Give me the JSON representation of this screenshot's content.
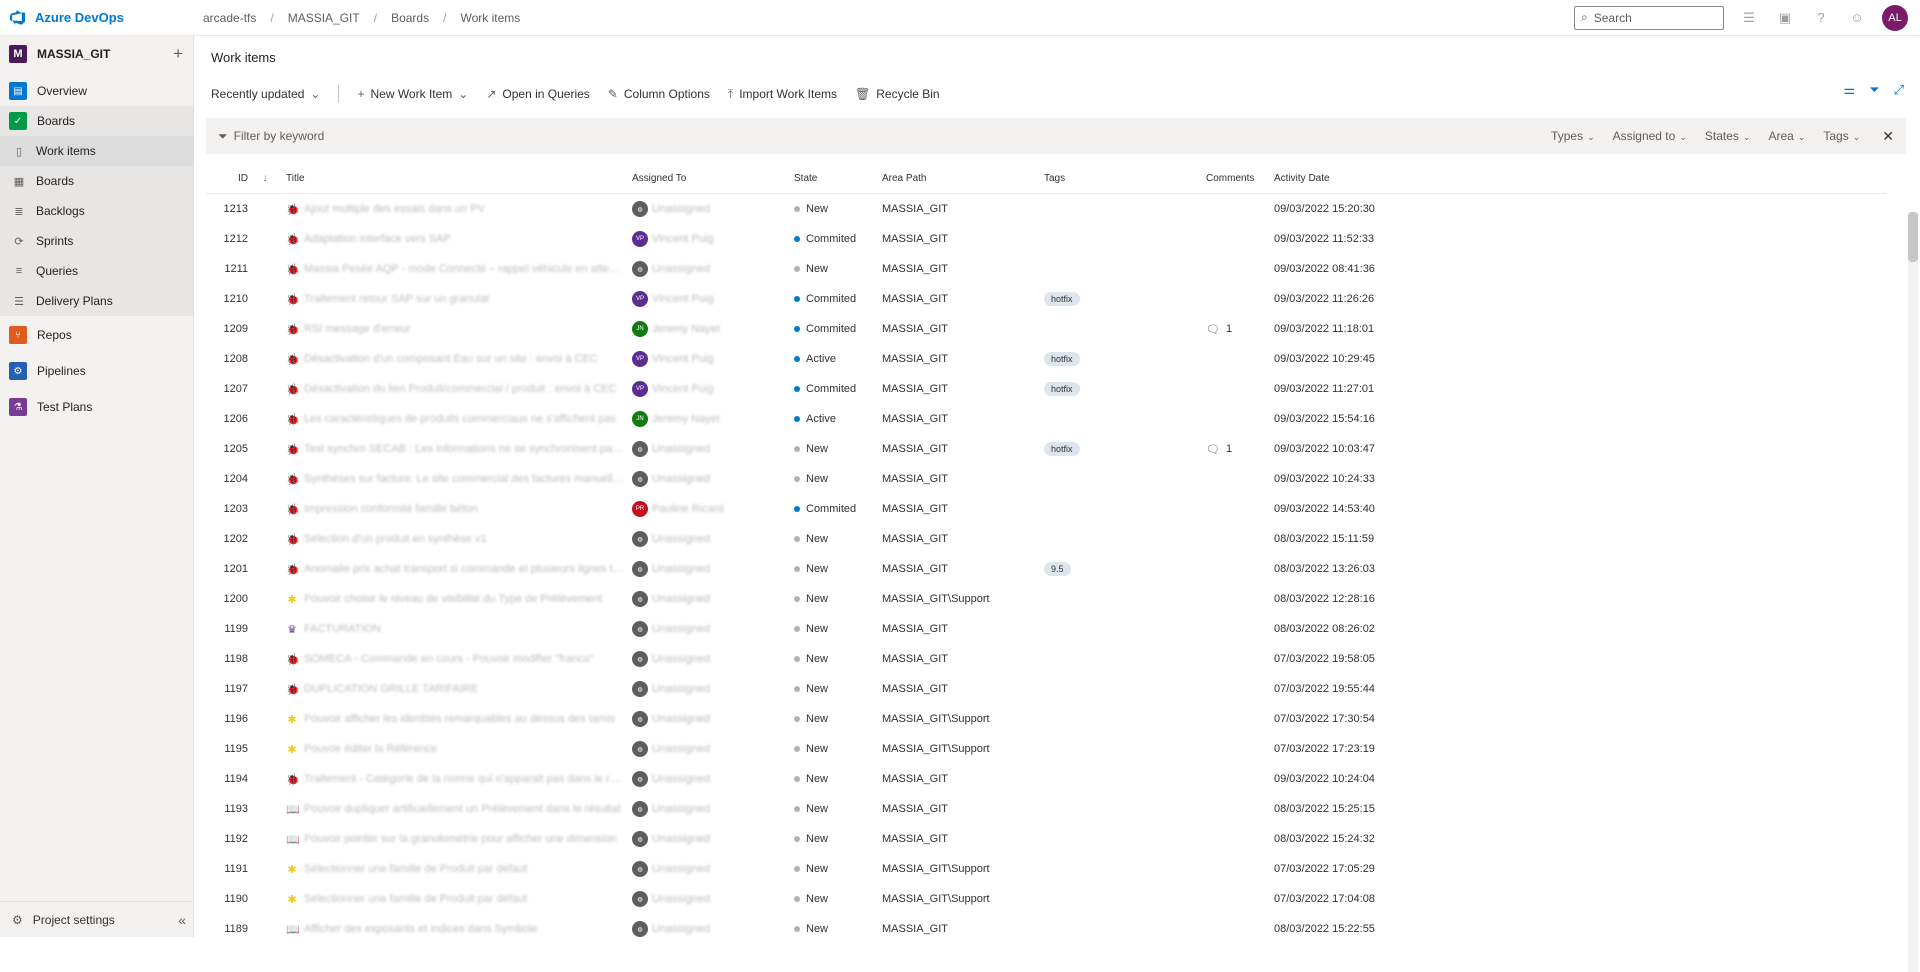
{
  "brand": "Azure DevOps",
  "breadcrumbs": [
    "arcade-tfs",
    "MASSIA_GIT",
    "Boards",
    "Work items"
  ],
  "search": {
    "placeholder": "Search"
  },
  "user_initials": "AL",
  "project": {
    "badge": "M",
    "name": "MASSIA_GIT"
  },
  "nav": {
    "overview": "Overview",
    "boards": "Boards",
    "sub": {
      "work_items": "Work items",
      "boards": "Boards",
      "backlogs": "Backlogs",
      "sprints": "Sprints",
      "queries": "Queries",
      "delivery_plans": "Delivery Plans"
    },
    "repos": "Repos",
    "pipelines": "Pipelines",
    "test_plans": "Test Plans"
  },
  "project_settings": "Project settings",
  "page_title": "Work items",
  "commands": {
    "view": "Recently updated",
    "new_item": "New Work Item",
    "open_queries": "Open in Queries",
    "column_options": "Column Options",
    "import": "Import Work Items",
    "recycle": "Recycle Bin"
  },
  "filter": {
    "placeholder": "Filter by keyword",
    "types": "Types",
    "assigned_to": "Assigned to",
    "states": "States",
    "area": "Area",
    "tags": "Tags"
  },
  "columns": {
    "id": "ID",
    "title": "Title",
    "assigned_to": "Assigned To",
    "state": "State",
    "area_path": "Area Path",
    "tags": "Tags",
    "comments": "Comments",
    "activity_date": "Activity Date"
  },
  "colors": {
    "new": "#b2b2b2",
    "commited": "#007acc",
    "active": "#007acc",
    "accent": "#0078d4"
  },
  "rows": [
    {
      "id": "1213",
      "type": "bug",
      "title": "Ajout multiple des essais dans un PV",
      "assignee": "Unassigned",
      "av": "un",
      "state": "New",
      "area": "MASSIA_GIT",
      "tag": "",
      "comments": "",
      "date": "09/03/2022 15:20:30"
    },
    {
      "id": "1212",
      "type": "bug",
      "title": "Adaptation interface vers SAP",
      "assignee": "Vincent Puig",
      "av": "VP",
      "state": "Commited",
      "area": "MASSIA_GIT",
      "tag": "",
      "comments": "",
      "date": "09/03/2022 11:52:33"
    },
    {
      "id": "1211",
      "type": "bug",
      "title": "Massia Pesée AQP - mode Connecté – rappel véhicule en attente",
      "assignee": "Unassigned",
      "av": "un",
      "state": "New",
      "area": "MASSIA_GIT",
      "tag": "",
      "comments": "",
      "date": "09/03/2022 08:41:36"
    },
    {
      "id": "1210",
      "type": "bug",
      "title": "Traitement retour SAP sur un granulat",
      "assignee": "Vincent Puig",
      "av": "VP",
      "state": "Commited",
      "area": "MASSIA_GIT",
      "tag": "hotfix",
      "comments": "",
      "date": "09/03/2022 11:26:26"
    },
    {
      "id": "1209",
      "type": "bug",
      "title": "RSI message d'erreur",
      "assignee": "Jeremy Nayet",
      "av": "JN",
      "state": "Commited",
      "area": "MASSIA_GIT",
      "tag": "",
      "comments": "1",
      "date": "09/03/2022 11:18:01"
    },
    {
      "id": "1208",
      "type": "bug",
      "title": "Désactivation d'un composant Eau sur un site : envoi à CEC",
      "assignee": "Vincent Puig",
      "av": "VP",
      "state": "Active",
      "area": "MASSIA_GIT",
      "tag": "hotfix",
      "comments": "",
      "date": "09/03/2022 10:29:45"
    },
    {
      "id": "1207",
      "type": "bug",
      "title": "Désactivation du lien Produit/commercial / produit : envoi à CEC",
      "assignee": "Vincent Puig",
      "av": "VP",
      "state": "Commited",
      "area": "MASSIA_GIT",
      "tag": "hotfix",
      "comments": "",
      "date": "09/03/2022 11:27:01"
    },
    {
      "id": "1206",
      "type": "bug",
      "title": "Les caractéristiques de produits commerciaux ne s'affichent pas",
      "assignee": "Jeremy Nayet",
      "av": "JN",
      "state": "Active",
      "area": "MASSIA_GIT",
      "tag": "",
      "comments": "",
      "date": "09/03/2022 15:54:16"
    },
    {
      "id": "1205",
      "type": "bug",
      "title": "Test synchro SECAB : Les informations ne se synchronisent pas du",
      "assignee": "Unassigned",
      "av": "un",
      "state": "New",
      "area": "MASSIA_GIT",
      "tag": "hotfix",
      "comments": "1",
      "date": "09/03/2022 10:03:47"
    },
    {
      "id": "1204",
      "type": "bug",
      "title": "Synthèses sur facture: Le site commercial des factures manuelles",
      "assignee": "Unassigned",
      "av": "un",
      "state": "New",
      "area": "MASSIA_GIT",
      "tag": "",
      "comments": "",
      "date": "09/03/2022 10:24:33"
    },
    {
      "id": "1203",
      "type": "bug",
      "title": "Impression conformité famille béton",
      "assignee": "Pauline Ricard",
      "av": "PR",
      "state": "Commited",
      "area": "MASSIA_GIT",
      "tag": "",
      "comments": "",
      "date": "09/03/2022 14:53:40"
    },
    {
      "id": "1202",
      "type": "bug",
      "title": "Sélection d'un produit en synthèse v1",
      "assignee": "Unassigned",
      "av": "un",
      "state": "New",
      "area": "MASSIA_GIT",
      "tag": "",
      "comments": "",
      "date": "08/03/2022 15:11:59"
    },
    {
      "id": "1201",
      "type": "bug",
      "title": "Anomalie prix achat transport si commande et plusieurs lignes tran",
      "assignee": "Unassigned",
      "av": "un",
      "state": "New",
      "area": "MASSIA_GIT",
      "tag": "9.5",
      "comments": "",
      "date": "08/03/2022 13:26:03"
    },
    {
      "id": "1200",
      "type": "feature",
      "title": "Pouvoir choisir le niveau de visibilité du Type de Prélèvement",
      "assignee": "Unassigned",
      "av": "un",
      "state": "New",
      "area": "MASSIA_GIT\\Support",
      "tag": "",
      "comments": "",
      "date": "08/03/2022 12:28:16"
    },
    {
      "id": "1199",
      "type": "epic",
      "title": "FACTURATION",
      "assignee": "Unassigned",
      "av": "un",
      "state": "New",
      "area": "MASSIA_GIT",
      "tag": "",
      "comments": "",
      "date": "08/03/2022 08:26:02"
    },
    {
      "id": "1198",
      "type": "bug",
      "title": "SOMECA - Commande en cours - Pouvoir modifier \"franco\"",
      "assignee": "Unassigned",
      "av": "un",
      "state": "New",
      "area": "MASSIA_GIT",
      "tag": "",
      "comments": "",
      "date": "07/03/2022 19:58:05"
    },
    {
      "id": "1197",
      "type": "bug",
      "title": "DUPLICATION GRILLE TARIFAIRE",
      "assignee": "Unassigned",
      "av": "un",
      "state": "New",
      "area": "MASSIA_GIT",
      "tag": "",
      "comments": "",
      "date": "07/03/2022 19:55:44"
    },
    {
      "id": "1196",
      "type": "feature",
      "title": "Pouvoir afficher les identités remarquables au dessus des tamis",
      "assignee": "Unassigned",
      "av": "un",
      "state": "New",
      "area": "MASSIA_GIT\\Support",
      "tag": "",
      "comments": "",
      "date": "07/03/2022 17:30:54"
    },
    {
      "id": "1195",
      "type": "feature",
      "title": "Pouvoir éditer la Référence",
      "assignee": "Unassigned",
      "av": "un",
      "state": "New",
      "area": "MASSIA_GIT\\Support",
      "tag": "",
      "comments": "",
      "date": "07/03/2022 17:23:19"
    },
    {
      "id": "1194",
      "type": "bug",
      "title": "Traitement - Catégorie de la norme qui n'apparait pas dans le résul",
      "assignee": "Unassigned",
      "av": "un",
      "state": "New",
      "area": "MASSIA_GIT",
      "tag": "",
      "comments": "",
      "date": "09/03/2022 10:24:04"
    },
    {
      "id": "1193",
      "type": "story",
      "title": "Pouvoir dupliquer artificiellement un Prélèvement dans le résultat",
      "assignee": "Unassigned",
      "av": "un",
      "state": "New",
      "area": "MASSIA_GIT",
      "tag": "",
      "comments": "",
      "date": "08/03/2022 15:25:15"
    },
    {
      "id": "1192",
      "type": "story",
      "title": "Pouvoir pointer sur la granulométrie pour afficher une dimension",
      "assignee": "Unassigned",
      "av": "un",
      "state": "New",
      "area": "MASSIA_GIT",
      "tag": "",
      "comments": "",
      "date": "08/03/2022 15:24:32"
    },
    {
      "id": "1191",
      "type": "feature",
      "title": "Sélectionner une famille de Produit par défaut",
      "assignee": "Unassigned",
      "av": "un",
      "state": "New",
      "area": "MASSIA_GIT\\Support",
      "tag": "",
      "comments": "",
      "date": "07/03/2022 17:05:29"
    },
    {
      "id": "1190",
      "type": "feature",
      "title": "Sélectionner une famille de Produit par défaut",
      "assignee": "Unassigned",
      "av": "un",
      "state": "New",
      "area": "MASSIA_GIT\\Support",
      "tag": "",
      "comments": "",
      "date": "07/03/2022 17:04:08"
    },
    {
      "id": "1189",
      "type": "story",
      "title": "Afficher des exposants et indices dans Symbole",
      "assignee": "Unassigned",
      "av": "un",
      "state": "New",
      "area": "MASSIA_GIT",
      "tag": "",
      "comments": "",
      "date": "08/03/2022 15:22:55"
    }
  ]
}
